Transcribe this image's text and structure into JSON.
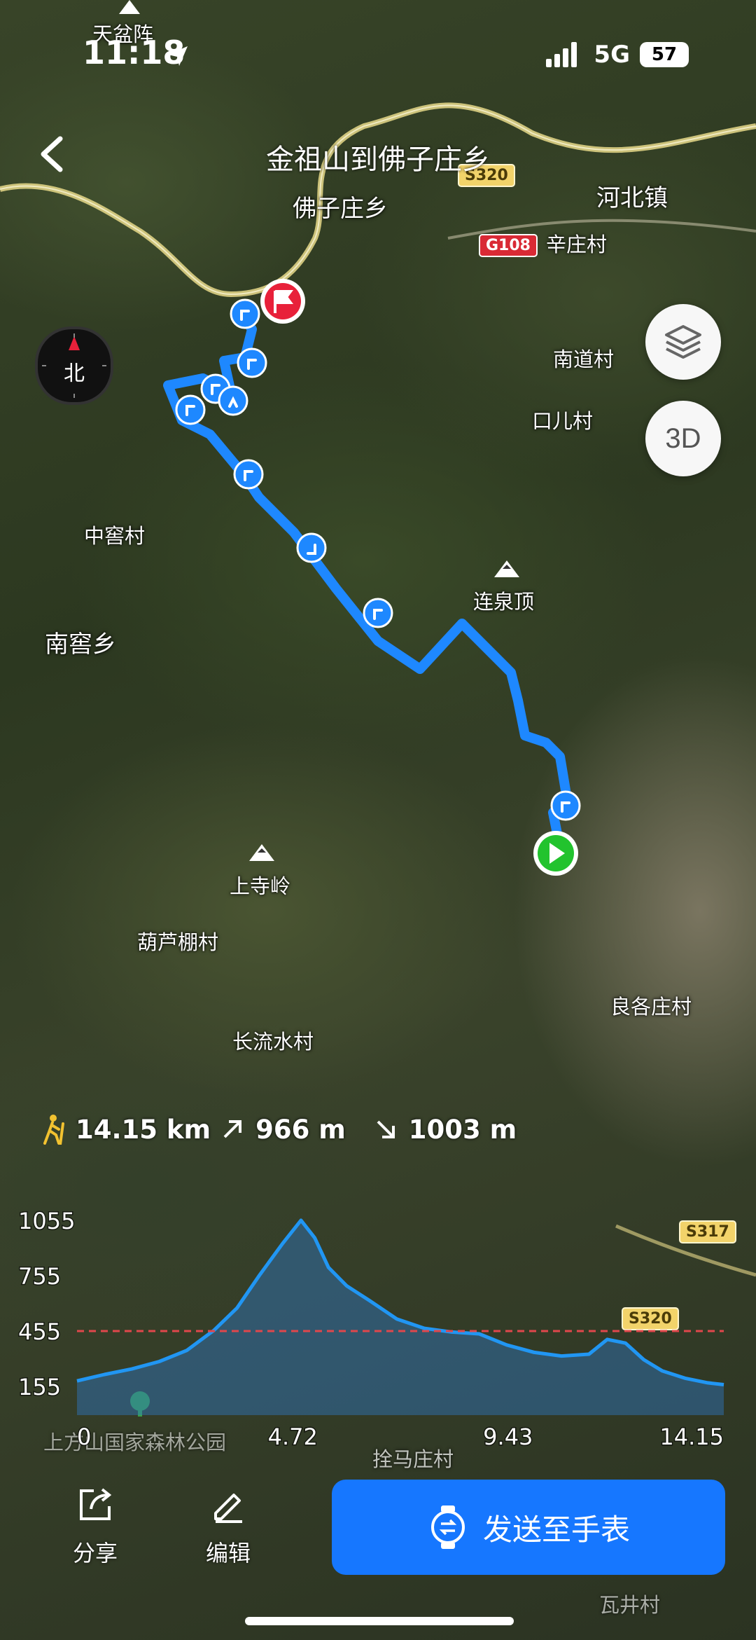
{
  "status_bar": {
    "time": "11:18",
    "network": "5G",
    "battery": "57"
  },
  "header": {
    "title": "金祖山到佛子庄乡"
  },
  "map": {
    "labels": [
      "天盆阵",
      "佛子庄乡",
      "河北镇",
      "辛庄村",
      "南道村",
      "口儿村",
      "中窖村",
      "南窖乡",
      "连泉顶",
      "上寺岭",
      "葫芦棚村",
      "良各庄村",
      "长流水村",
      "上方山国家森林公园",
      "拴马庄村",
      "瓦井村"
    ],
    "road_shields": [
      "S320",
      "G108",
      "S317",
      "S320"
    ],
    "compass_label": "北",
    "layers_icon": "layers-icon",
    "mode_3d_label": "3D",
    "route_color": "#1e88ff",
    "start_color": "#22c32e",
    "end_color": "#e8213a"
  },
  "stats": {
    "distance": "14.15 km",
    "ascent": "966 m",
    "descent": "1003 m"
  },
  "chart_data": {
    "type": "area",
    "xlabel": "",
    "ylabel": "",
    "x_ticks": [
      "0",
      "4.72",
      "9.43",
      "14.15"
    ],
    "y_ticks": [
      "1055",
      "755",
      "455",
      "155"
    ],
    "xlim": [
      0,
      14.15
    ],
    "ylim": [
      0,
      1100
    ],
    "reference_line": 455,
    "series": [
      {
        "x": [
          0,
          0.6,
          1.2,
          1.8,
          2.4,
          3.0,
          3.5,
          4.0,
          4.5,
          4.9,
          5.2,
          5.5,
          5.9,
          6.4,
          7.0,
          7.6,
          8.2,
          8.8,
          9.4,
          10.0,
          10.6,
          11.2,
          11.6,
          12.0,
          12.4,
          12.8,
          13.3,
          13.8,
          14.15
        ],
        "y": [
          185,
          220,
          250,
          290,
          350,
          460,
          580,
          760,
          930,
          1055,
          960,
          800,
          700,
          620,
          520,
          470,
          450,
          440,
          380,
          340,
          320,
          330,
          410,
          390,
          300,
          240,
          200,
          175,
          165
        ]
      }
    ],
    "colors": {
      "line": "#2196f3",
      "fill": "#2f78c4",
      "reference": "#e0474c"
    }
  },
  "actions": {
    "share_label": "分享",
    "edit_label": "编辑",
    "send_label": "发送至手表"
  }
}
